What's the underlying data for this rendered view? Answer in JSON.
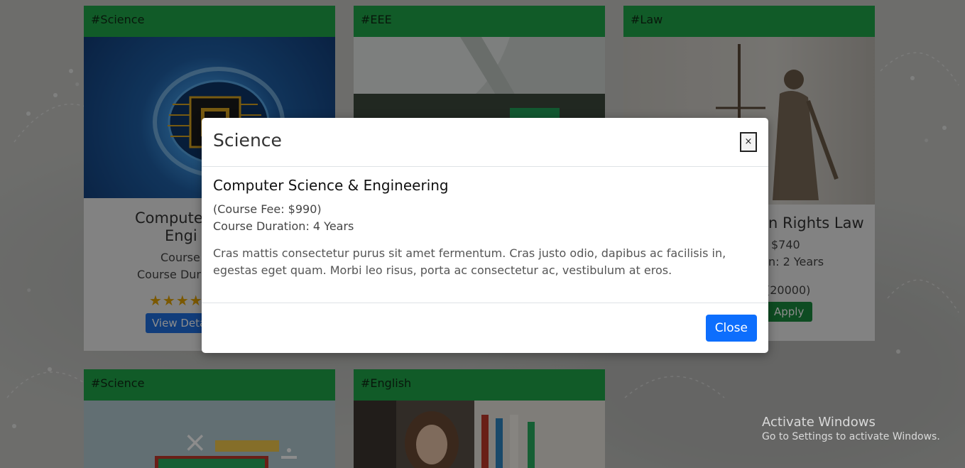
{
  "cards": [
    {
      "tag": "#Science",
      "title_line1": "Compute",
      "title_line2": "Engi",
      "fee_partial": "Course",
      "duration_partial": "Course Dur",
      "rating_stars": 4,
      "details_partial": "View Deta"
    },
    {
      "tag": "#EEE"
    },
    {
      "tag": "#Law",
      "title_partial": "n Rights Law",
      "fee_partial": "$740",
      "duration_partial": "n: 2 Years",
      "reviews_partial": "(20000)",
      "apply_label": "Apply"
    },
    {
      "tag": "#Science"
    },
    {
      "tag": "#English"
    }
  ],
  "modal": {
    "title": "Science",
    "close_x": "×",
    "course_title": "Computer Science & Engineering",
    "fee": "(Course Fee: $990)",
    "duration": "Course Duration: 4 Years",
    "description": "Cras mattis consectetur purus sit amet fermentum. Cras justo odio, dapibus ac facilisis in, egestas eget quam. Morbi leo risus, porta ac consectetur ac, vestibulum at eros.",
    "close_button": "Close"
  },
  "watermark": {
    "line1": "Activate Windows",
    "line2": "Go to Settings to activate Windows."
  },
  "colors": {
    "tag_green": "#1fa64a",
    "primary_blue": "#0d6efd",
    "star_gold": "#e0a100"
  }
}
